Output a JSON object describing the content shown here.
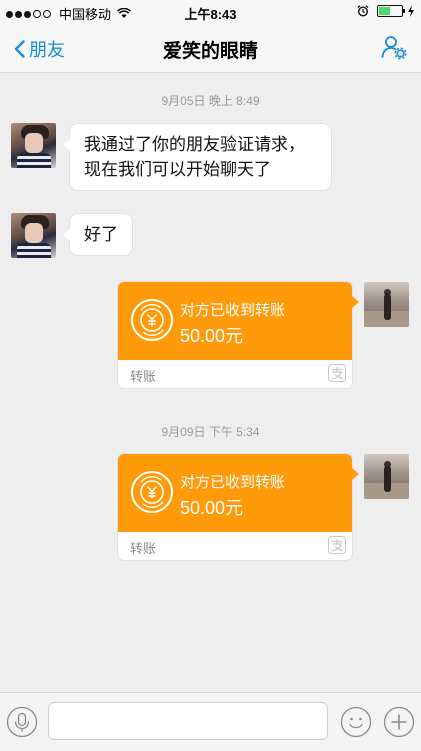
{
  "status_bar": {
    "carrier": "中国移动",
    "time": "上午8:43"
  },
  "nav": {
    "back_label": "朋友",
    "title": "爱笑的眼睛"
  },
  "messages": [
    {
      "timestamp": "9月05日 晚上 8:49"
    },
    {
      "line1": "我通过了你的朋友验证请求，",
      "line2": "现在我们可以开始聊天了"
    },
    {
      "text": "好了"
    },
    {
      "status": "对方已收到转账",
      "amount": "50.00元",
      "label": "转账"
    },
    {
      "timestamp": "9月09日 下午 5:34"
    },
    {
      "status": "对方已收到转账",
      "amount": "50.00元",
      "label": "转账"
    }
  ],
  "input_bar": {
    "placeholder": ""
  },
  "colors": {
    "accent": "#1a8cd8",
    "transfer": "#ff9a0a",
    "background": "#eeeeef"
  }
}
